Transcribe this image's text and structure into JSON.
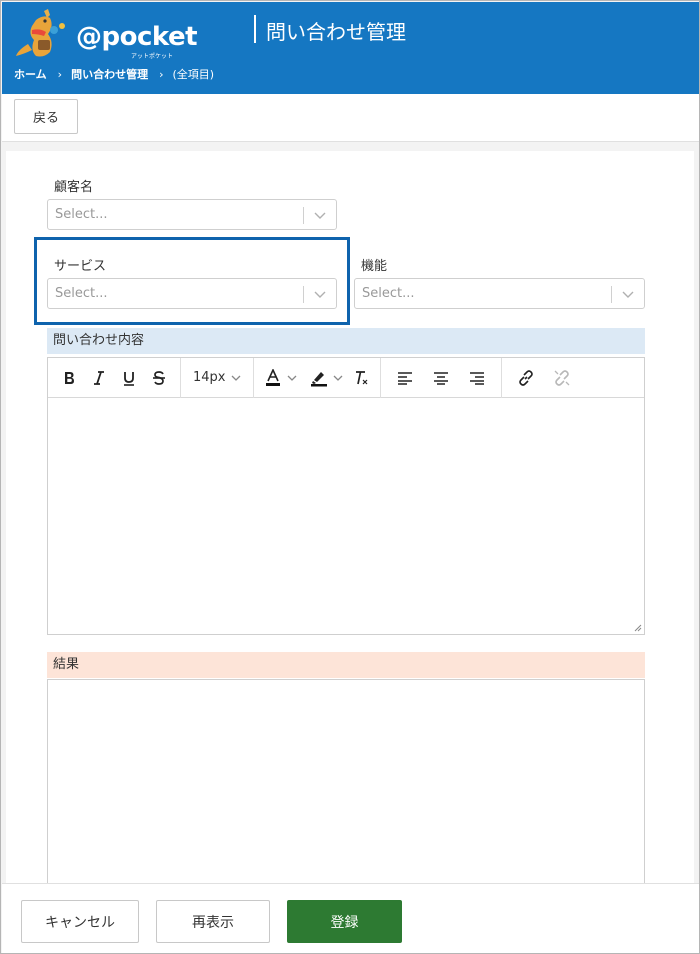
{
  "header": {
    "logo_text": "@pocket",
    "logo_sub": "アットポケット",
    "title": "問い合わせ管理",
    "breadcrumb": [
      {
        "label": "ホーム"
      },
      {
        "label": "問い合わせ管理"
      },
      {
        "label": "(全項目)"
      }
    ],
    "breadcrumb_sep": "›",
    "background": "#1577c2"
  },
  "topbar": {
    "back_label": "戻る"
  },
  "form": {
    "customer": {
      "label": "顧客名",
      "placeholder": "Select..."
    },
    "service": {
      "label": "サービス",
      "placeholder": "Select..."
    },
    "feature": {
      "label": "機能",
      "placeholder": "Select..."
    },
    "inquiry": {
      "label": "問い合わせ内容"
    },
    "result": {
      "label": "結果"
    },
    "editor": {
      "font_size": "14px"
    }
  },
  "footer": {
    "cancel_label": "キャンセル",
    "redisplay_label": "再表示",
    "register_label": "登録",
    "primary_color": "#2d7a32"
  },
  "icons": {
    "logo": "kangaroo-logo-icon",
    "dropdown": "chevron-down-icon",
    "bold": "bold-icon",
    "italic": "italic-icon",
    "underline": "underline-icon",
    "strike": "strikethrough-icon",
    "font_color": "font-color-icon",
    "highlight": "highlighter-icon",
    "clear": "clear-format-icon",
    "align_left": "align-left-icon",
    "align_center": "align-center-icon",
    "align_right": "align-right-icon",
    "link": "link-icon",
    "unlink": "unlink-icon"
  }
}
